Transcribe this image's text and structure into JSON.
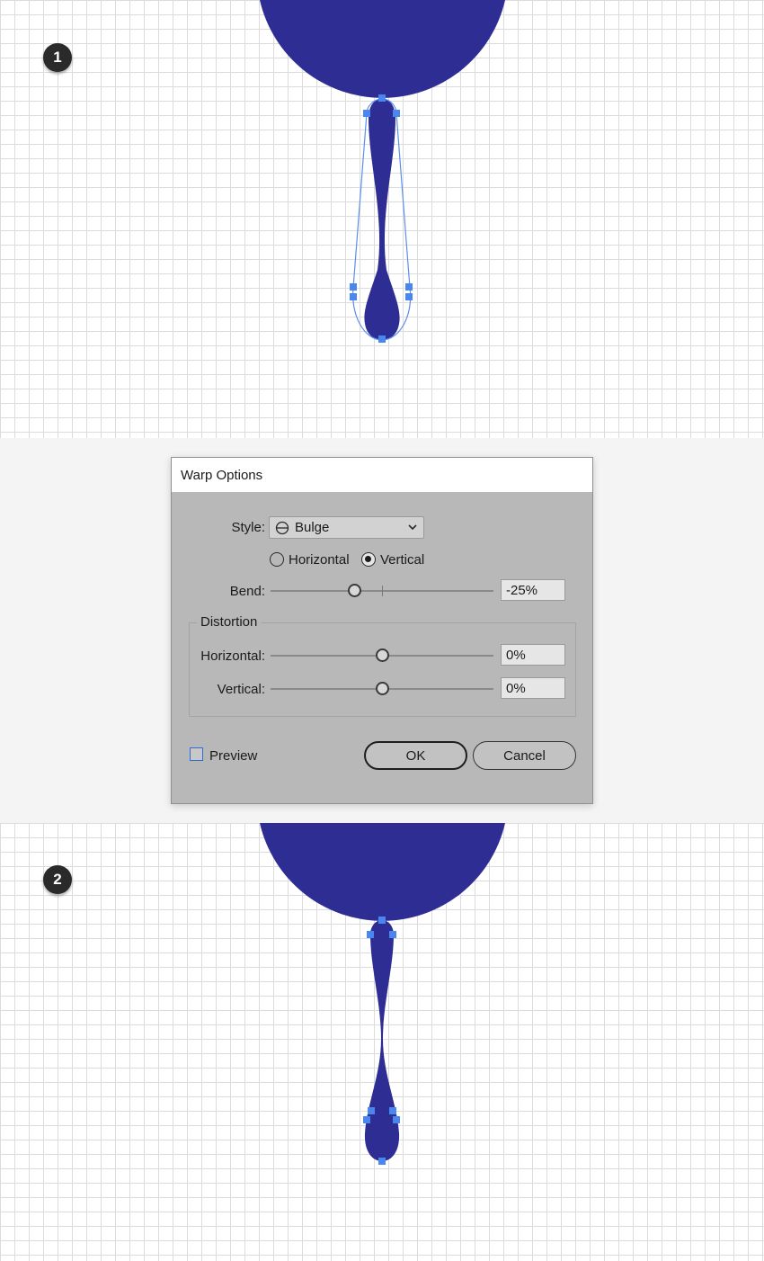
{
  "colors": {
    "shape_fill": "#2e2d94",
    "anchor": "#4a86f0",
    "path_stroke": "#5b8ef0"
  },
  "steps": [
    "1",
    "2"
  ],
  "dialog": {
    "title": "Warp Options",
    "style_label": "Style:",
    "style_value": "Bulge",
    "style_icon": "bulge-icon",
    "orientation": {
      "horizontal_label": "Horizontal",
      "vertical_label": "Vertical",
      "selected": "Vertical"
    },
    "bend": {
      "label": "Bend:",
      "value": "-25%",
      "level": -25
    },
    "distortion": {
      "title": "Distortion",
      "horizontal": {
        "label": "Horizontal:",
        "value": "0%",
        "level": 0
      },
      "vertical": {
        "label": "Vertical:",
        "value": "0%",
        "level": 0
      }
    },
    "preview_label": "Preview",
    "preview_checked": false,
    "ok_label": "OK",
    "cancel_label": "Cancel"
  }
}
